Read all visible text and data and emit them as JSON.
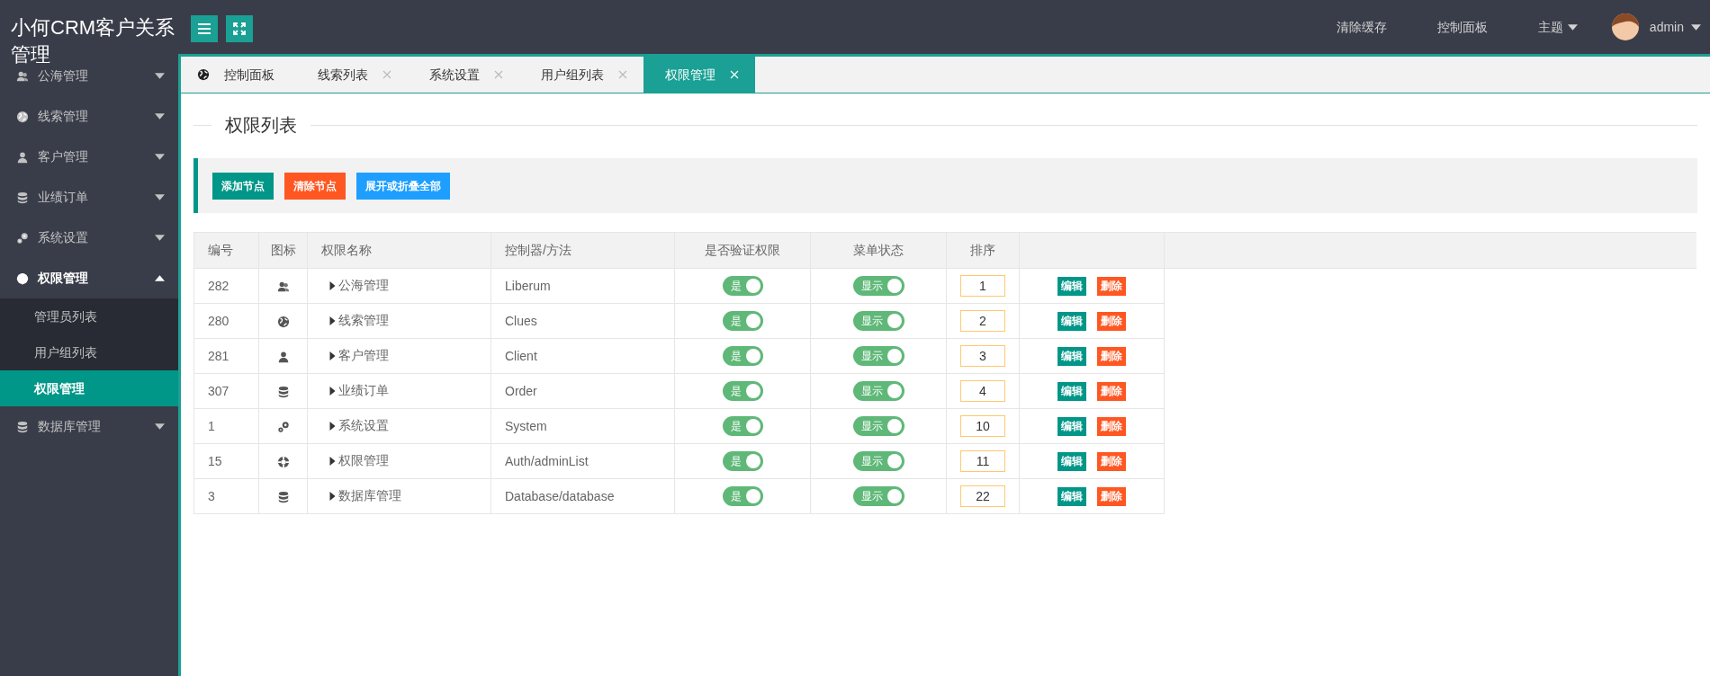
{
  "header": {
    "logo": "小何CRM客户关系管理",
    "nav": [
      {
        "label": "清除缓存",
        "dropdown": false
      },
      {
        "label": "控制面板",
        "dropdown": false
      },
      {
        "label": "主题",
        "dropdown": true
      }
    ],
    "user": {
      "name": "admin"
    }
  },
  "sidebar": {
    "items": [
      {
        "label": "公海管理",
        "expanded": false,
        "selected": false
      },
      {
        "label": "线索管理",
        "expanded": false,
        "selected": false
      },
      {
        "label": "客户管理",
        "expanded": false,
        "selected": false
      },
      {
        "label": "业绩订单",
        "expanded": false,
        "selected": false
      },
      {
        "label": "系统设置",
        "expanded": false,
        "selected": false
      },
      {
        "label": "权限管理",
        "expanded": true,
        "selected": false,
        "children": [
          {
            "label": "管理员列表",
            "selected": false
          },
          {
            "label": "用户组列表",
            "selected": false
          },
          {
            "label": "权限管理",
            "selected": true
          }
        ]
      },
      {
        "label": "数据库管理",
        "expanded": false,
        "selected": false
      }
    ]
  },
  "tabs": [
    {
      "label": "控制面板",
      "selected": false,
      "closable": false
    },
    {
      "label": "线索列表",
      "selected": false,
      "closable": true
    },
    {
      "label": "系统设置",
      "selected": false,
      "closable": true
    },
    {
      "label": "用户组列表",
      "selected": false,
      "closable": true
    },
    {
      "label": "权限管理",
      "selected": true,
      "closable": true
    }
  ],
  "page_title": "权限列表",
  "toolbar": [
    {
      "label": "添加节点",
      "kind": "primary"
    },
    {
      "label": "清除节点",
      "kind": "danger"
    },
    {
      "label": "展开或折叠全部",
      "kind": "info"
    }
  ],
  "table": {
    "columns": [
      "编号",
      "图标",
      "权限名称",
      "控制器/方法",
      "是否验证权限",
      "菜单状态",
      "排序"
    ],
    "rows": [
      {
        "id": "282",
        "name": "公海管理",
        "controller": "Liberum",
        "auth": {
          "label": "是",
          "on": true
        },
        "menu": {
          "label": "显示",
          "on": true
        },
        "sort": "1",
        "actions": [
          "编辑",
          "删除"
        ]
      },
      {
        "id": "280",
        "name": "线索管理",
        "controller": "Clues",
        "auth": {
          "label": "是",
          "on": true
        },
        "menu": {
          "label": "显示",
          "on": true
        },
        "sort": "2",
        "actions": [
          "编辑",
          "删除"
        ]
      },
      {
        "id": "281",
        "name": "客户管理",
        "controller": "Client",
        "auth": {
          "label": "是",
          "on": true
        },
        "menu": {
          "label": "显示",
          "on": true
        },
        "sort": "3",
        "actions": [
          "编辑",
          "删除"
        ]
      },
      {
        "id": "307",
        "name": "业绩订单",
        "controller": "Order",
        "auth": {
          "label": "是",
          "on": true
        },
        "menu": {
          "label": "显示",
          "on": true
        },
        "sort": "4",
        "actions": [
          "编辑",
          "删除"
        ]
      },
      {
        "id": "1",
        "name": "系统设置",
        "controller": "System",
        "auth": {
          "label": "是",
          "on": true
        },
        "menu": {
          "label": "显示",
          "on": true
        },
        "sort": "10",
        "actions": [
          "编辑",
          "删除"
        ]
      },
      {
        "id": "15",
        "name": "权限管理",
        "controller": "Auth/adminList",
        "auth": {
          "label": "是",
          "on": true
        },
        "menu": {
          "label": "显示",
          "on": true
        },
        "sort": "11",
        "actions": [
          "编辑",
          "删除"
        ]
      },
      {
        "id": "3",
        "name": "数据库管理",
        "controller": "Database/database",
        "auth": {
          "label": "是",
          "on": true
        },
        "menu": {
          "label": "显示",
          "on": true
        },
        "sort": "22",
        "actions": [
          "编辑",
          "删除"
        ]
      }
    ]
  }
}
